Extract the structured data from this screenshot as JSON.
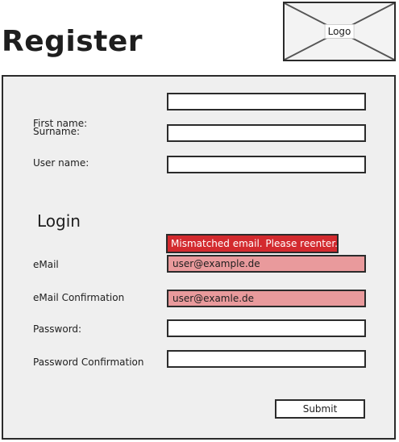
{
  "header": {
    "title": "Register",
    "logo_label": "Logo"
  },
  "form": {
    "personal": [
      {
        "label": "First name:",
        "value": ""
      },
      {
        "label": "Surname:",
        "value": ""
      },
      {
        "label": "User name:",
        "value": ""
      }
    ],
    "login_heading": "Login",
    "error_message": "Mismatched email. Please reenter.",
    "email": {
      "label": "eMail",
      "value": "user@example.de"
    },
    "email_confirm": {
      "label": "eMail Confirmation",
      "value": "user@examle.de"
    },
    "password": {
      "label": "Password:",
      "value": ""
    },
    "password_confirm": {
      "label": "Password Confirmation",
      "value": ""
    },
    "submit_label": "Submit"
  },
  "colors": {
    "error_banner": "#d32a2e",
    "error_field": "#e99a9c",
    "panel_background": "#efefef"
  }
}
